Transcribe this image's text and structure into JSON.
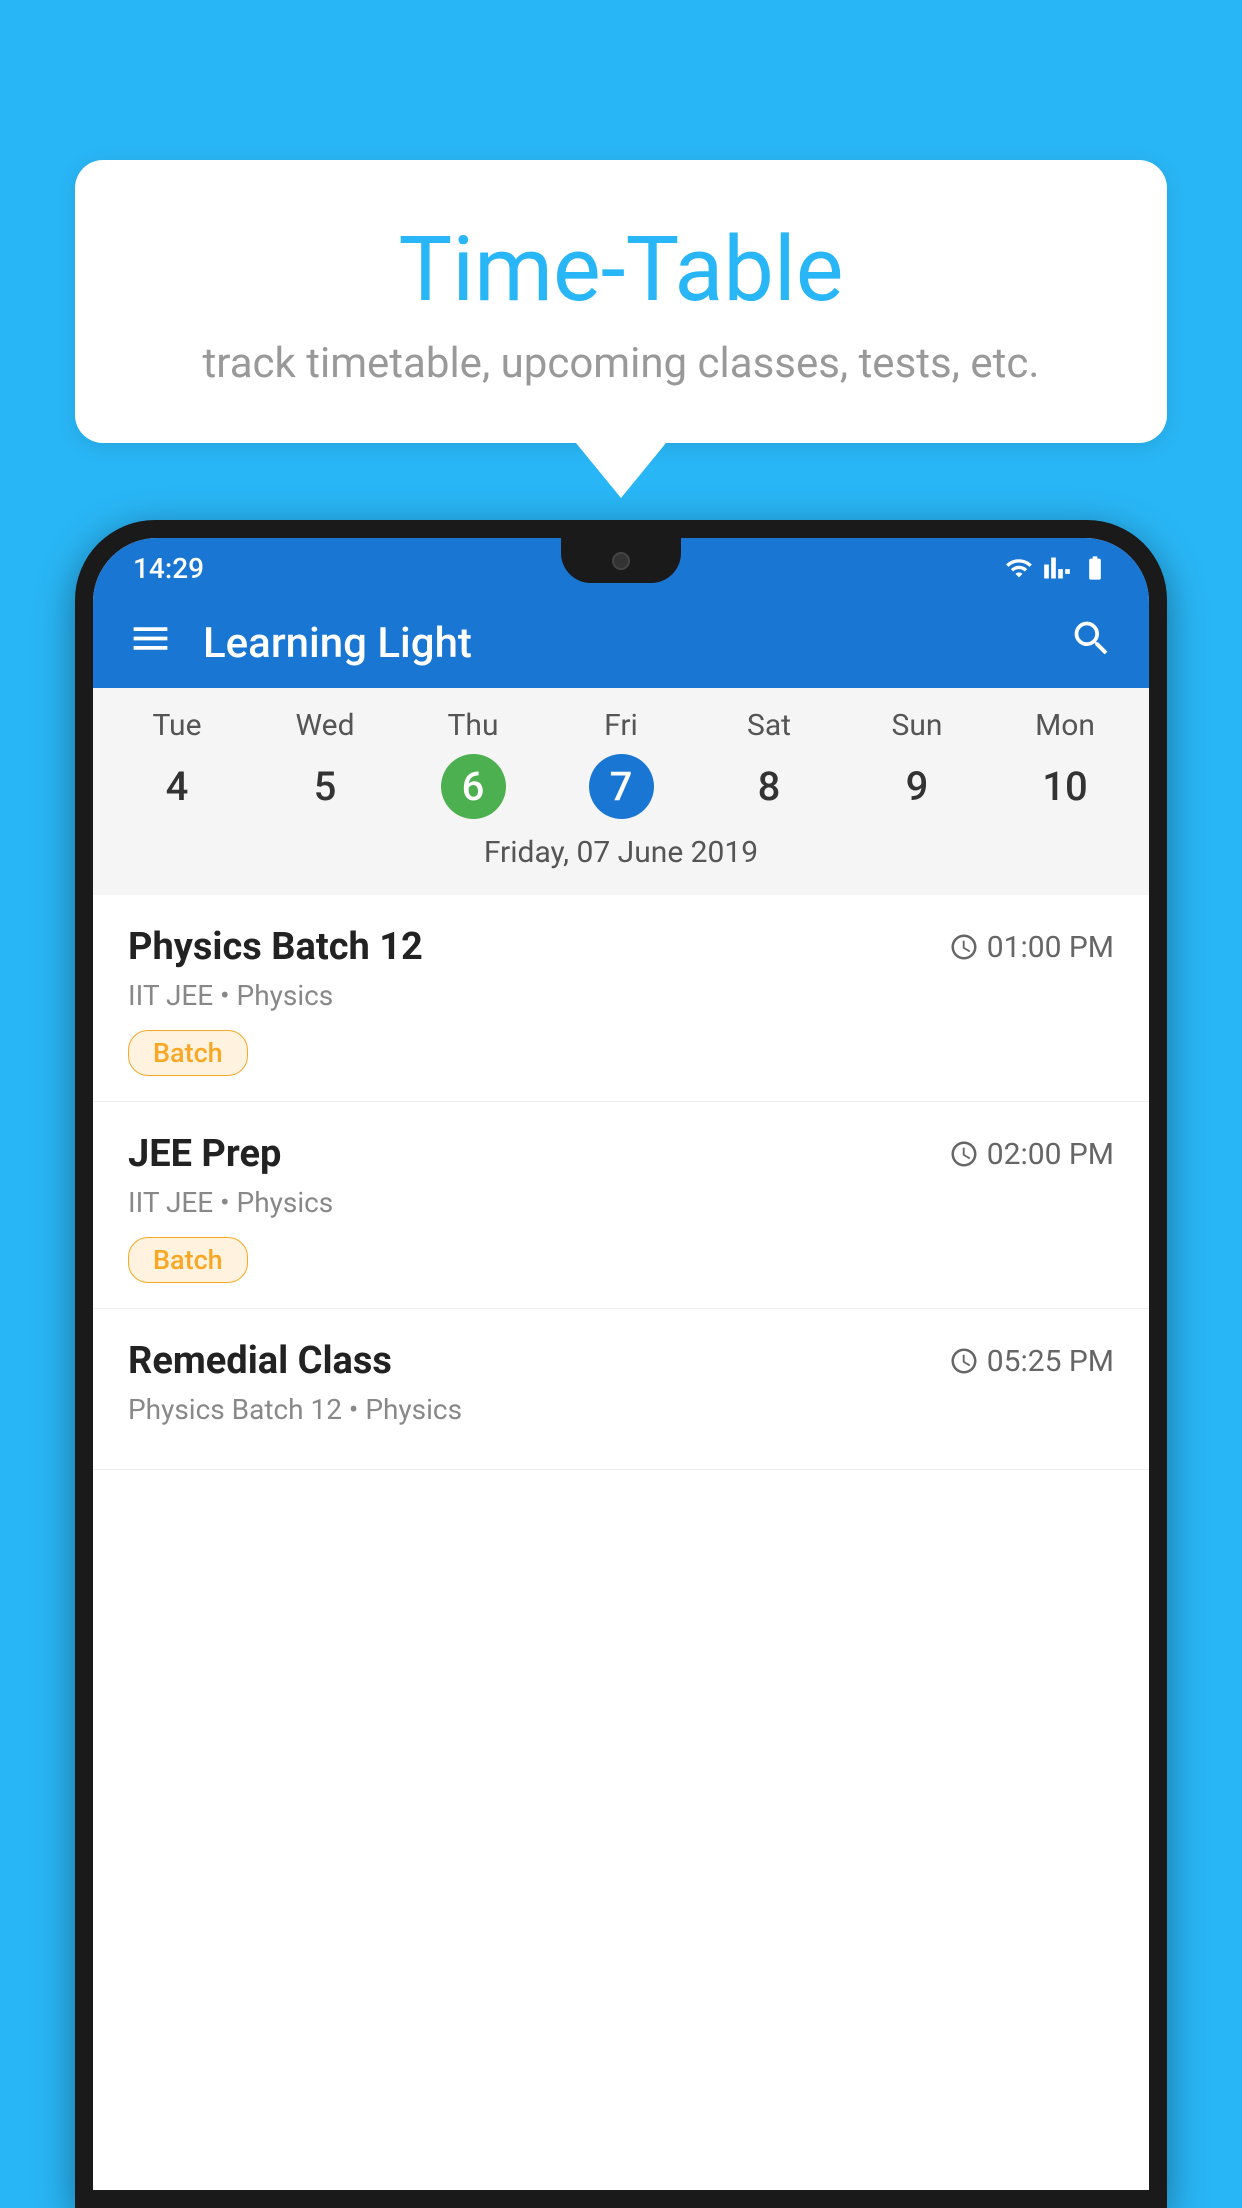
{
  "background_color": "#29B6F6",
  "speech_bubble": {
    "title": "Time-Table",
    "subtitle": "track timetable, upcoming classes, tests, etc."
  },
  "phone": {
    "status_bar": {
      "time": "14:29",
      "icons": [
        "wifi",
        "signal",
        "battery"
      ]
    },
    "app_bar": {
      "title": "Learning Light",
      "menu_icon": "menu",
      "search_icon": "search"
    },
    "calendar": {
      "day_names": [
        "Tue",
        "Wed",
        "Thu",
        "Fri",
        "Sat",
        "Sun",
        "Mon"
      ],
      "day_numbers": [
        "4",
        "5",
        "6",
        "7",
        "8",
        "9",
        "10"
      ],
      "today_index": 2,
      "selected_index": 3,
      "selected_date_label": "Friday, 07 June 2019"
    },
    "classes": [
      {
        "title": "Physics Batch 12",
        "time": "01:00 PM",
        "subtitle": "IIT JEE • Physics",
        "badge": "Batch"
      },
      {
        "title": "JEE Prep",
        "time": "02:00 PM",
        "subtitle": "IIT JEE • Physics",
        "badge": "Batch"
      },
      {
        "title": "Remedial Class",
        "time": "05:25 PM",
        "subtitle": "Physics Batch 12 • Physics",
        "badge": ""
      }
    ]
  }
}
